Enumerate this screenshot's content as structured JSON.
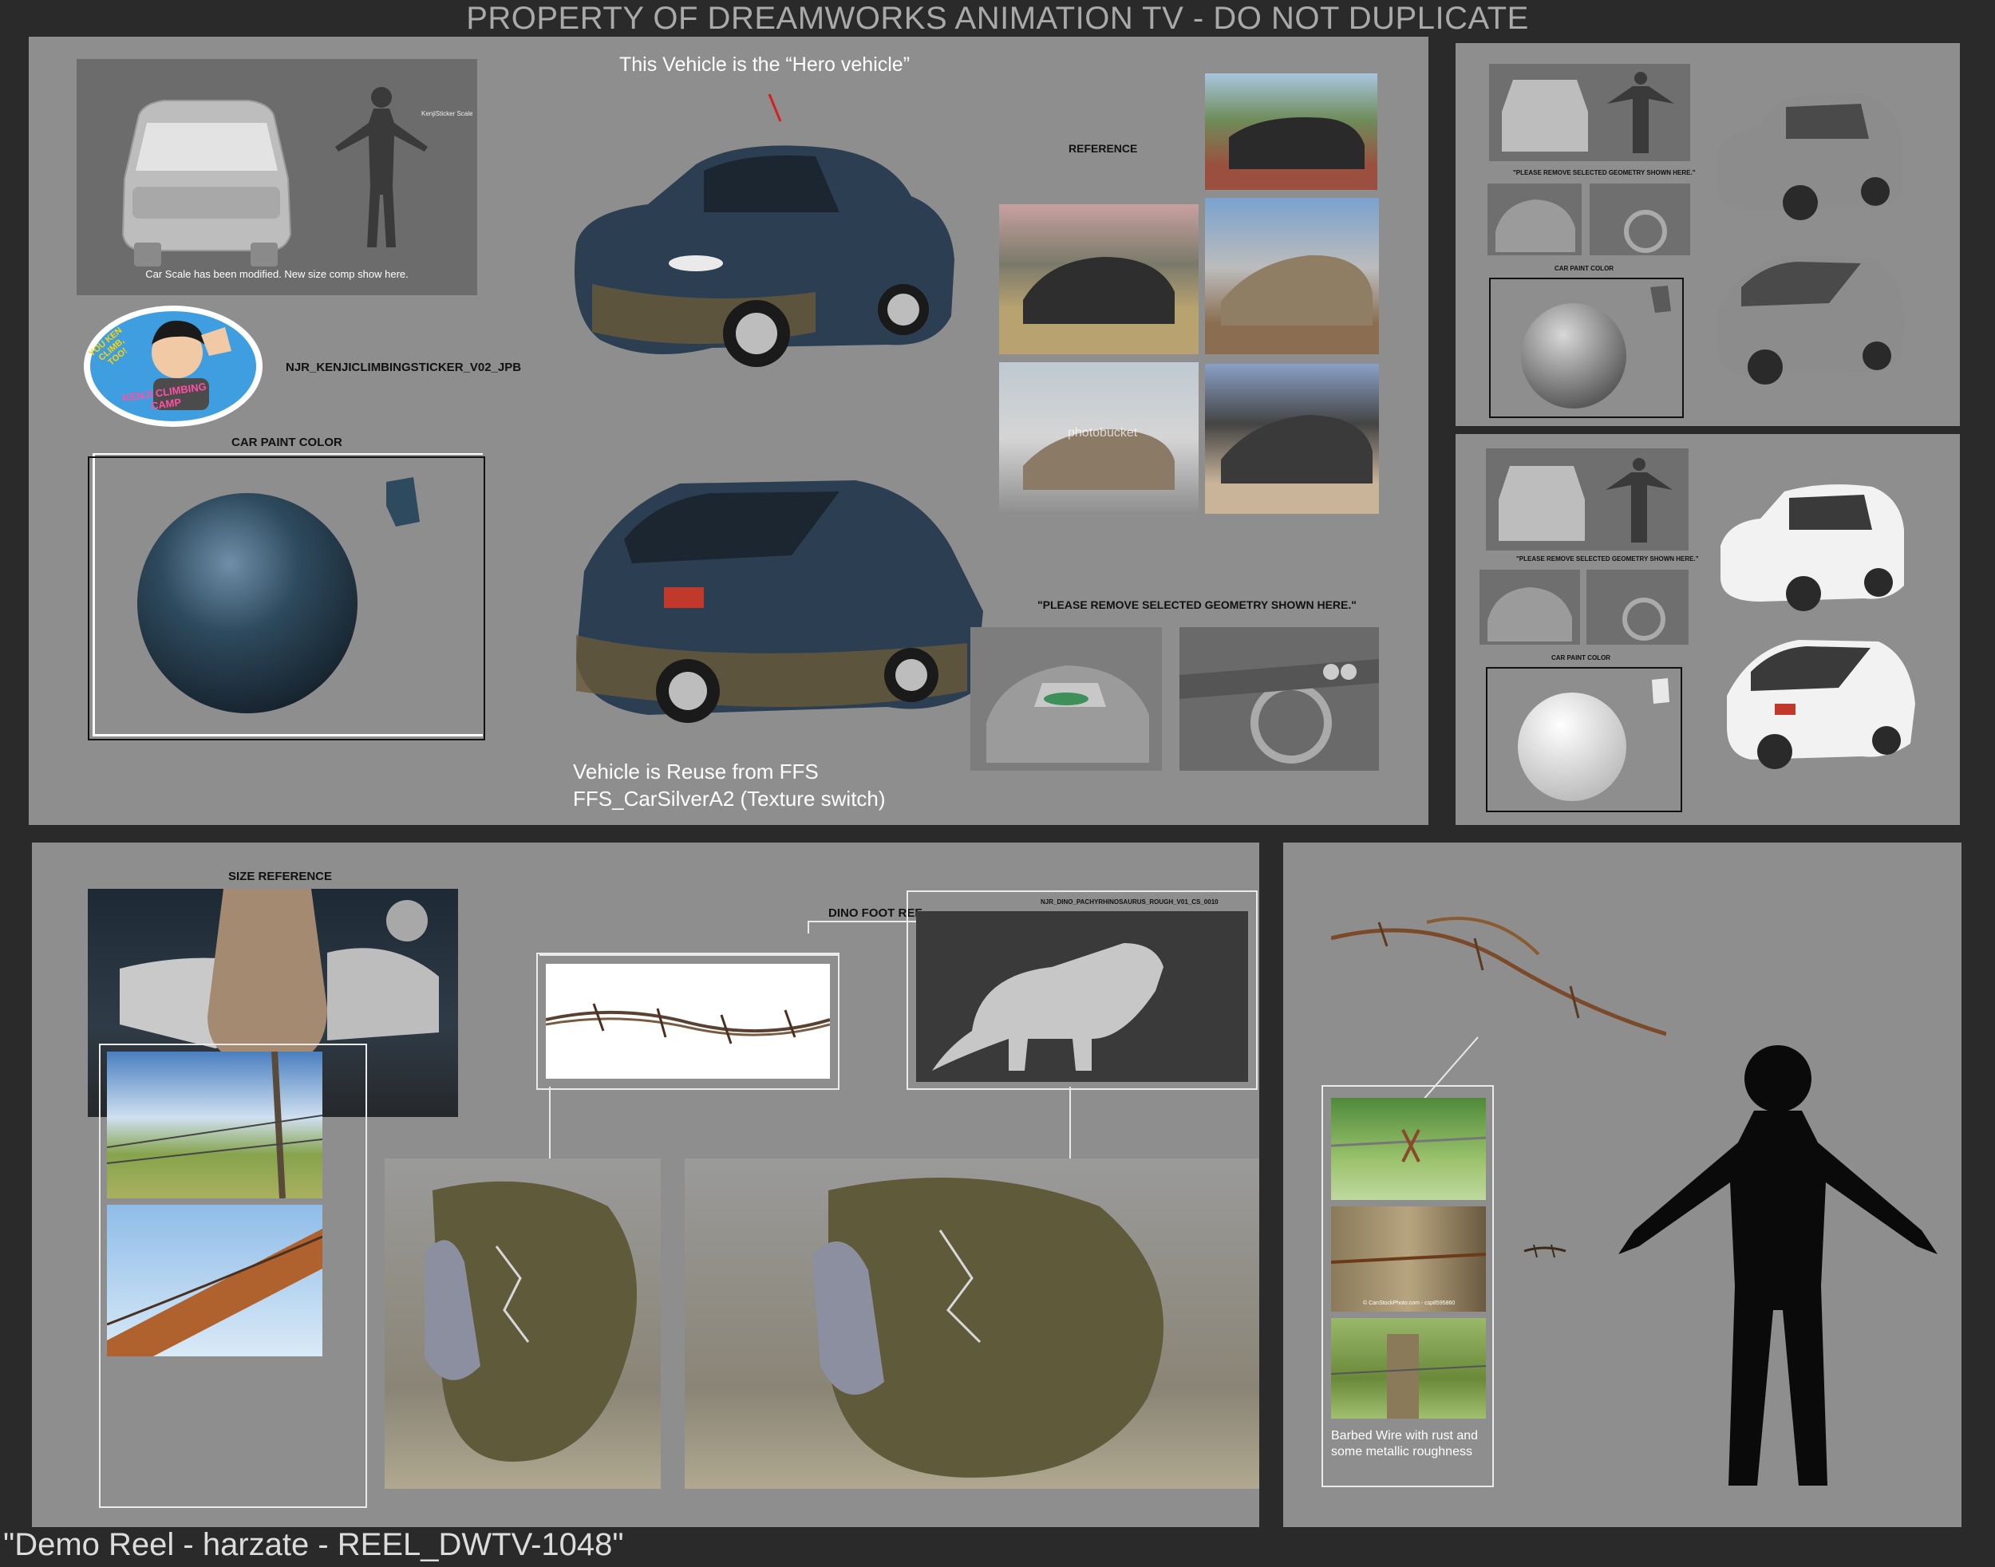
{
  "header": {
    "title": "PROPERTY OF DREAMWORKS ANIMATION TV - DO NOT DUPLICATE"
  },
  "footer": {
    "caption": "\"Demo Reel - harzate - REEL_DWTV-1048\""
  },
  "vehicle_panel": {
    "hero_note": "This Vehicle is  the “Hero vehicle”",
    "scale_label": "KenjiSticker Scale",
    "scale_note": "Car Scale has been modified. New size comp show here.",
    "sticker_file": "NJR_KENJICLIMBINGSTICKER_V02_JPB",
    "sticker_text_top": "YOU KEN CLIMB, TOO!",
    "sticker_text_bottom": "KENJI CLIMBING CAMP",
    "paint_label": "CAR PAINT COLOR",
    "reference_label": "REFERENCE",
    "remove_label": "\"PLEASE REMOVE SELECTED GEOMETRY SHOWN HERE.\"",
    "reuse_line1": "Vehicle is Reuse from FFS",
    "reuse_line2": "FFS_CarSilverA2 (Texture switch)",
    "watermark": "photobucket"
  },
  "variant_panels": {
    "remove_label": "\"PLEASE REMOVE SELECTED GEOMETRY SHOWN HERE.\"",
    "paint_label": "CAR PAINT COLOR"
  },
  "dino_panel": {
    "size_label": "SIZE REFERENCE",
    "dino_label": "DINO FOOT REF",
    "dino_file": "NJR_DINO_PACHYRHINOSAURUS_ROUGH_V01_CS_0010"
  },
  "wire_panel": {
    "wire_note": "Barbed Wire with rust and some metallic roughness",
    "watermark": "© CanStockPhoto.com - csp8595860"
  },
  "colors": {
    "background": "#2a2a2a",
    "panel": "#8e8e8e",
    "car_paint": "#2e4a5e",
    "header_text": "#a9a9a9"
  }
}
